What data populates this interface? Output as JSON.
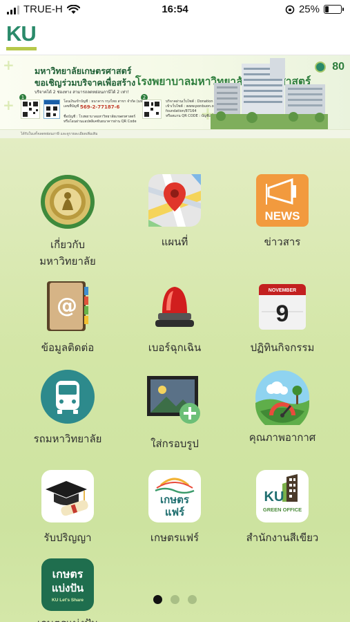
{
  "status_bar": {
    "carrier": "TRUE-H",
    "time": "16:54",
    "battery": "25%",
    "battery_level": 0.25
  },
  "header": {
    "logo_text": "KU"
  },
  "banner": {
    "title_line1": "มหาวิทยาลัยเกษตรศาสตร์",
    "title_line2": "ขอเชิญร่วมบริจาคเพื่อสร้าง",
    "title_highlight": "โรงพยาบาลมหาวิทยาลัยเกษตรศาสตร์",
    "subtitle": "บริจาคได้ 2 ช่องทาง   สามารถลดหย่อนภาษีได้ 2 เท่า!",
    "step1": "1",
    "step1_info": "โอนเงินเข้าบัญชี : ธนาคาร กรุงไทย สาขา จำกัด (มหาชน)\nเลขที่บัญชี :",
    "step1_account": "569-2-77187-6",
    "step1_note": "ชื่อบัญชี : โรงพยาบาลมหาวิทยาลัยเกษตรศาสตร์\nหรือโอนผ่านแอปพลิเคชันธนาคารผ่าน QR Code",
    "step2": "2",
    "step2_info": "บริจาคผ่านเว็บไซต์ : Donation\nเข้าเว็บไซต์ : www.ponbuon.org\nfoundation/87164\nหรือสแกน QR CODE : บัญชีเสร็จในทันที",
    "footer": "ได้รับใบเสร็จลดหย่อนภาษี และดูรายละเอียดเพิ่มเติม",
    "anniversary": "80"
  },
  "apps": [
    {
      "label": "เกี่ยวกับ\nมหาวิทยาลัย",
      "icon": "university-seal-icon"
    },
    {
      "label": "แผนที่",
      "icon": "map-icon"
    },
    {
      "label": "ข่าวสาร",
      "icon": "news-icon",
      "badge": "NEWS"
    },
    {
      "label": "ข้อมูลติดต่อ",
      "icon": "contacts-book-icon"
    },
    {
      "label": "เบอร์ฉุกเฉิน",
      "icon": "emergency-siren-icon"
    },
    {
      "label": "ปฏิทินกิจกรรม",
      "icon": "calendar-icon",
      "month": "NOVEMBER",
      "day": "9"
    },
    {
      "label": "รถมหาวิทยาลัย",
      "icon": "bus-icon"
    },
    {
      "label": "ใส่กรอบรูป",
      "icon": "add-photo-frame-icon"
    },
    {
      "label": "คุณภาพอากาศ",
      "icon": "air-quality-icon"
    },
    {
      "label": "รับปริญญา",
      "icon": "graduation-cap-icon"
    },
    {
      "label": "เกษตรแฟร์",
      "icon": "kaset-fair-icon",
      "badge_top": "เกษตร",
      "badge_bottom": "แฟร์"
    },
    {
      "label": "สำนักงานสีเขียว",
      "icon": "green-office-icon",
      "badge_top": "KU",
      "badge_bottom": "GREEN OFFICE"
    },
    {
      "label": "เกษตรแบ่งปัน",
      "icon": "kaset-share-icon",
      "badge_top": "เกษตร",
      "badge_mid": "แบ่งปัน",
      "badge_bottom": "KU Let's Share"
    }
  ],
  "pagination": {
    "pages": 3,
    "current": 1
  },
  "colors": {
    "ku_green": "#2a8a6a",
    "ku_lime": "#b6c84a",
    "background": "#d3e6a6"
  }
}
